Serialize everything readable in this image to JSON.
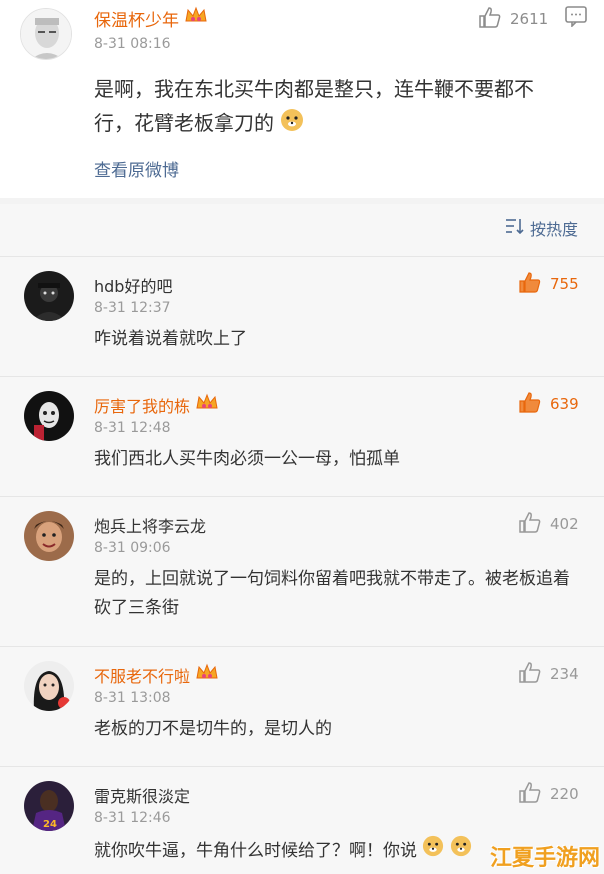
{
  "post": {
    "author": "保温杯少年",
    "time": "8-31 08:16",
    "text": "是啊，我在东北买牛肉都是整只，连牛鞭不要都不行，花臂老板拿刀的",
    "likes": "2611",
    "view_original": "查看原微博"
  },
  "sort": {
    "label": "按热度"
  },
  "comments": [
    {
      "name": "hdb好的吧",
      "time": "8-31 12:37",
      "text": "咋说着说着就吹上了",
      "likes": "755",
      "vip": false,
      "hot": true
    },
    {
      "name": "厉害了我的栋",
      "time": "8-31 12:48",
      "text": "我们西北人买牛肉必须一公一母，怕孤单",
      "likes": "639",
      "vip": true,
      "hot": true
    },
    {
      "name": "炮兵上将李云龙",
      "time": "8-31 09:06",
      "text": "是的，上回就说了一句饲料你留着吧我就不带走了。被老板追着砍了三条街",
      "likes": "402",
      "vip": false,
      "hot": false
    },
    {
      "name": "不服老不行啦",
      "time": "8-31 13:08",
      "text": "老板的刀不是切牛的，是切人的",
      "likes": "234",
      "vip": true,
      "hot": false
    },
    {
      "name": "雷克斯很淡定",
      "time": "8-31 12:46",
      "text": "就你吹牛逼，牛角什么时候给了？啊！你说",
      "likes": "220",
      "vip": false,
      "hot": false
    }
  ],
  "watermark": "江夏手游网",
  "colors": {
    "accent": "#e8670c",
    "link": "#4e6b93",
    "muted": "#9a9a9a"
  },
  "icons": [
    "crown-badge-icon",
    "thumbs-up-icon",
    "comment-icon",
    "sort-icon",
    "doge-emoji-icon"
  ]
}
